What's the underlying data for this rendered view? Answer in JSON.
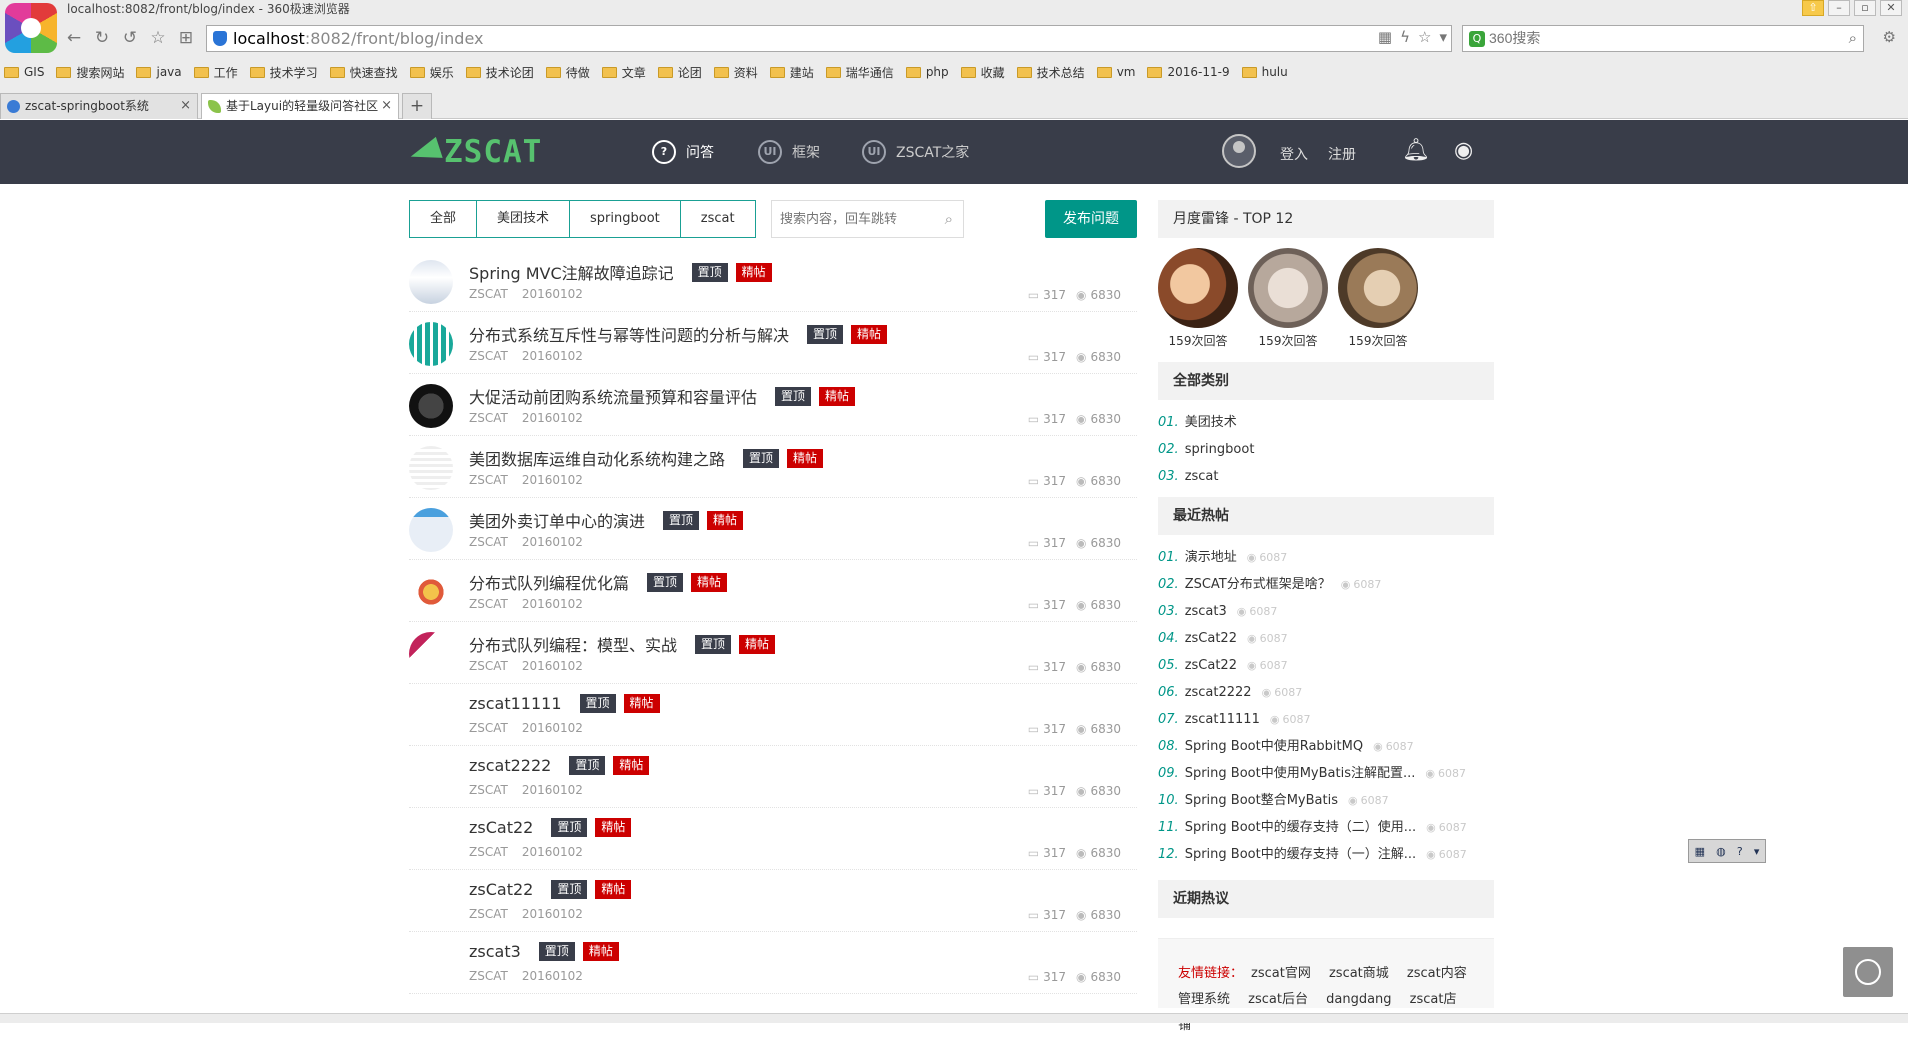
{
  "browser": {
    "window_title": "localhost:8082/front/blog/index - 360极速浏览器",
    "url_host": "localhost",
    "url_rest": ":8082/front/blog/index",
    "search_placeholder": "360搜索",
    "search_badge": "Q",
    "bookmarks": [
      "GIS",
      "搜索网站",
      "java",
      "工作",
      "技术学习",
      "快速查找",
      "娱乐",
      "技术论团",
      "待做",
      "文章",
      "论团",
      "资料",
      "建站",
      "瑞华通信",
      "php",
      "收藏",
      "技术总结",
      "vm",
      "2016-11-9",
      "hulu"
    ],
    "tabs": [
      {
        "title": "zscat-springboot系统",
        "active": false
      },
      {
        "title": "基于Layui的轻量级问答社区",
        "active": true
      }
    ],
    "new_tab": "+",
    "close_glyph": "×"
  },
  "site": {
    "logo_text": "ZSCAT",
    "nav": [
      {
        "icon": "?",
        "label": "问答",
        "active": true
      },
      {
        "icon": "UI",
        "label": "框架",
        "active": false
      },
      {
        "icon": "UI",
        "label": "ZSCAT之家",
        "active": false
      }
    ],
    "login": "登入",
    "register": "注册"
  },
  "filters": [
    "全部",
    "美团技术",
    "springboot",
    "zscat"
  ],
  "post_search_placeholder": "搜索内容，回车跳转",
  "ask_button": "发布问题",
  "badge_top": "置顶",
  "badge_good": "精帖",
  "posts": [
    {
      "title": "Spring MVC注解故障追踪记",
      "author": "ZSCAT",
      "date": "20160102",
      "comments": "317",
      "views": "6830"
    },
    {
      "title": "分布式系统互斥性与幂等性问题的分析与解决",
      "author": "ZSCAT",
      "date": "20160102",
      "comments": "317",
      "views": "6830"
    },
    {
      "title": "大促活动前团购系统流量预算和容量评估",
      "author": "ZSCAT",
      "date": "20160102",
      "comments": "317",
      "views": "6830"
    },
    {
      "title": "美团数据库运维自动化系统构建之路",
      "author": "ZSCAT",
      "date": "20160102",
      "comments": "317",
      "views": "6830"
    },
    {
      "title": "美团外卖订单中心的演进",
      "author": "ZSCAT",
      "date": "20160102",
      "comments": "317",
      "views": "6830"
    },
    {
      "title": "分布式队列编程优化篇",
      "author": "ZSCAT",
      "date": "20160102",
      "comments": "317",
      "views": "6830"
    },
    {
      "title": "分布式队列编程：模型、实战",
      "author": "ZSCAT",
      "date": "20160102",
      "comments": "317",
      "views": "6830"
    },
    {
      "title": "zscat11111",
      "author": "ZSCAT",
      "date": "20160102",
      "comments": "317",
      "views": "6830"
    },
    {
      "title": "zscat2222",
      "author": "ZSCAT",
      "date": "20160102",
      "comments": "317",
      "views": "6830"
    },
    {
      "title": "zsCat22",
      "author": "ZSCAT",
      "date": "20160102",
      "comments": "317",
      "views": "6830"
    },
    {
      "title": "zsCat22",
      "author": "ZSCAT",
      "date": "20160102",
      "comments": "317",
      "views": "6830"
    },
    {
      "title": "zscat3",
      "author": "ZSCAT",
      "date": "20160102",
      "comments": "317",
      "views": "6830"
    }
  ],
  "sidebar": {
    "top12_title": "月度雷锋 - TOP 12",
    "top_users": [
      {
        "answers": "159次回答"
      },
      {
        "answers": "159次回答"
      },
      {
        "answers": "159次回答"
      }
    ],
    "categories_title": "全部类别",
    "categories": [
      {
        "num": "01.",
        "name": "美团技术"
      },
      {
        "num": "02.",
        "name": "springboot"
      },
      {
        "num": "03.",
        "name": "zscat"
      }
    ],
    "hot_title": "最近热帖",
    "hot": [
      {
        "num": "01.",
        "title": "演示地址",
        "views": "6087"
      },
      {
        "num": "02.",
        "title": "ZSCAT分布式框架是啥？",
        "views": "6087"
      },
      {
        "num": "03.",
        "title": "zscat3",
        "views": "6087"
      },
      {
        "num": "04.",
        "title": "zsCat22",
        "views": "6087"
      },
      {
        "num": "05.",
        "title": "zsCat22",
        "views": "6087"
      },
      {
        "num": "06.",
        "title": "zscat2222",
        "views": "6087"
      },
      {
        "num": "07.",
        "title": "zscat11111",
        "views": "6087"
      },
      {
        "num": "08.",
        "title": "Spring Boot中使用RabbitMQ",
        "views": "6087"
      },
      {
        "num": "09.",
        "title": "Spring Boot中使用MyBatis注解配置...",
        "views": "6087"
      },
      {
        "num": "10.",
        "title": "Spring Boot整合MyBatis",
        "views": "6087"
      },
      {
        "num": "11.",
        "title": "Spring Boot中的缓存支持（二）使用...",
        "views": "6087"
      },
      {
        "num": "12.",
        "title": "Spring Boot中的缓存支持（一）注解...",
        "views": "6087"
      }
    ],
    "recent_title": "近期热议",
    "friend_label": "友情链接：",
    "friend_links": [
      "zscat官网",
      "zscat商城",
      "zscat内容管理系统",
      "zscat后台",
      "dangdang",
      "zscat店铺"
    ]
  },
  "colors": {
    "accent": "#009688",
    "header_bg": "#393d49",
    "badge_red": "#cc0000",
    "logo_green": "#57c26f"
  },
  "icons": {
    "bell": "bell-icon",
    "weibo": "weibo-icon",
    "eye": "eye-icon",
    "comment": "comment-icon"
  }
}
